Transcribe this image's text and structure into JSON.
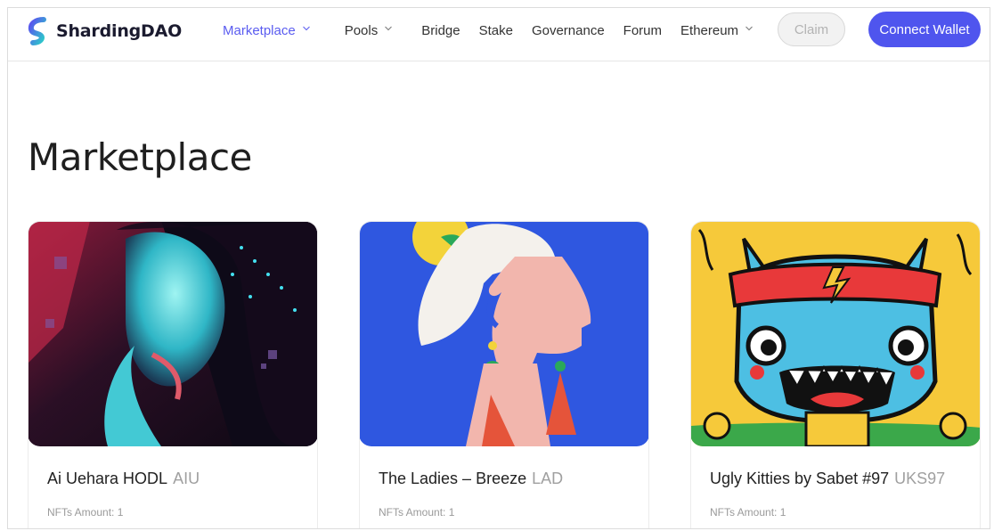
{
  "header": {
    "logo_text": "ShardingDAO",
    "nav": [
      {
        "label": "Marketplace",
        "has_dropdown": true,
        "active": true
      },
      {
        "label": "Pools",
        "has_dropdown": true,
        "active": false
      },
      {
        "label": "Bridge",
        "has_dropdown": false,
        "active": false
      },
      {
        "label": "Stake",
        "has_dropdown": false,
        "active": false
      },
      {
        "label": "Governance",
        "has_dropdown": false,
        "active": false
      },
      {
        "label": "Forum",
        "has_dropdown": false,
        "active": false
      },
      {
        "label": "Ethereum",
        "has_dropdown": true,
        "active": false
      }
    ],
    "claim_label": "Claim",
    "connect_label": "Connect Wallet"
  },
  "main": {
    "title": "Marketplace",
    "cards": [
      {
        "name": "Ai Uehara HODL",
        "symbol": "AIU",
        "amount": "NFTs Amount: 1",
        "image_icon": "portrait-artwork"
      },
      {
        "name": "The Ladies – Breeze",
        "symbol": "LAD",
        "amount": "NFTs Amount: 1",
        "image_icon": "abstract-lady-artwork"
      },
      {
        "name": "Ugly Kitties by Sabet #97",
        "symbol": "UKS97",
        "amount": "NFTs Amount: 1",
        "image_icon": "cartoon-cat-artwork"
      }
    ]
  },
  "colors": {
    "accent": "#4f55ee",
    "nav_active": "#5a5cf0",
    "text": "#333333",
    "muted": "#9a9a9a"
  }
}
